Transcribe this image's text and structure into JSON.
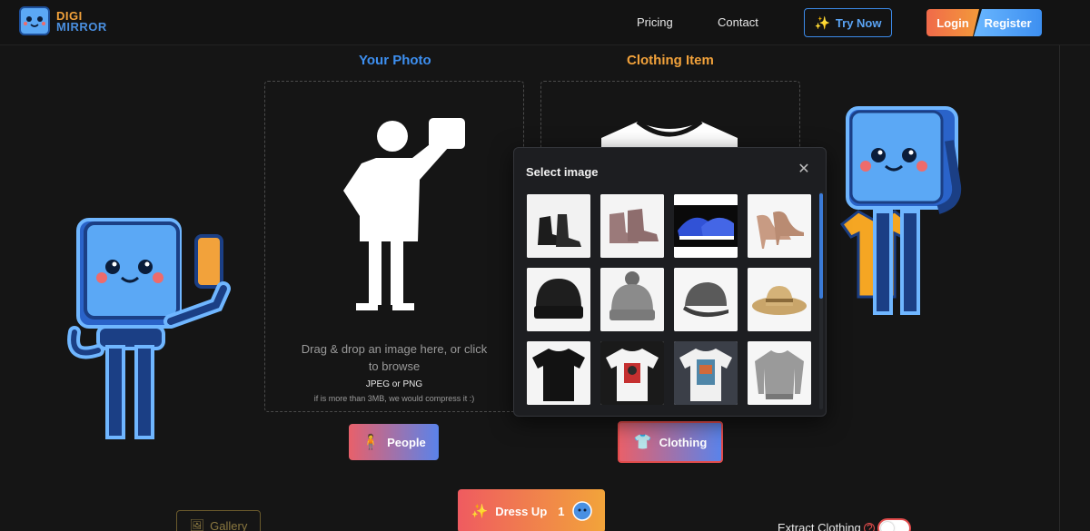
{
  "header": {
    "logo_line1": "DIGI",
    "logo_line2": "MIRROR",
    "nav": [
      "Pricing",
      "Contact"
    ],
    "try_now": "Try Now",
    "login": "Login",
    "register": "Register"
  },
  "photo": {
    "title": "Your Photo",
    "drop_text": "Drag & drop an image here, or click to browse",
    "format": "JPEG or PNG",
    "compress_note": "if is more than 3MB, we would compress it :)",
    "button": "People"
  },
  "clothing": {
    "title": "Clothing Item",
    "button": "Clothing"
  },
  "modal": {
    "title": "Select image",
    "close": "✕",
    "items": [
      "black-boots",
      "mauve-chelsea-boots",
      "blue-sneakers",
      "nude-high-heels",
      "black-beanie",
      "grey-pompom-beanie",
      "grey-baseball-cap",
      "straw-sun-hat",
      "black-tshirt",
      "white-graphic-tshirt",
      "white-print-tshirt",
      "grey-knit-sweater"
    ]
  },
  "footer": {
    "gallery": "Gallery",
    "dress_up": "Dress Up",
    "dress_up_count": "1",
    "extract_clothing": "Extract Clothing"
  },
  "colors": {
    "photo_title": "#3d8ff0",
    "clothing_title": "#f2a23b",
    "accent_blue": "#3c8ae8"
  }
}
